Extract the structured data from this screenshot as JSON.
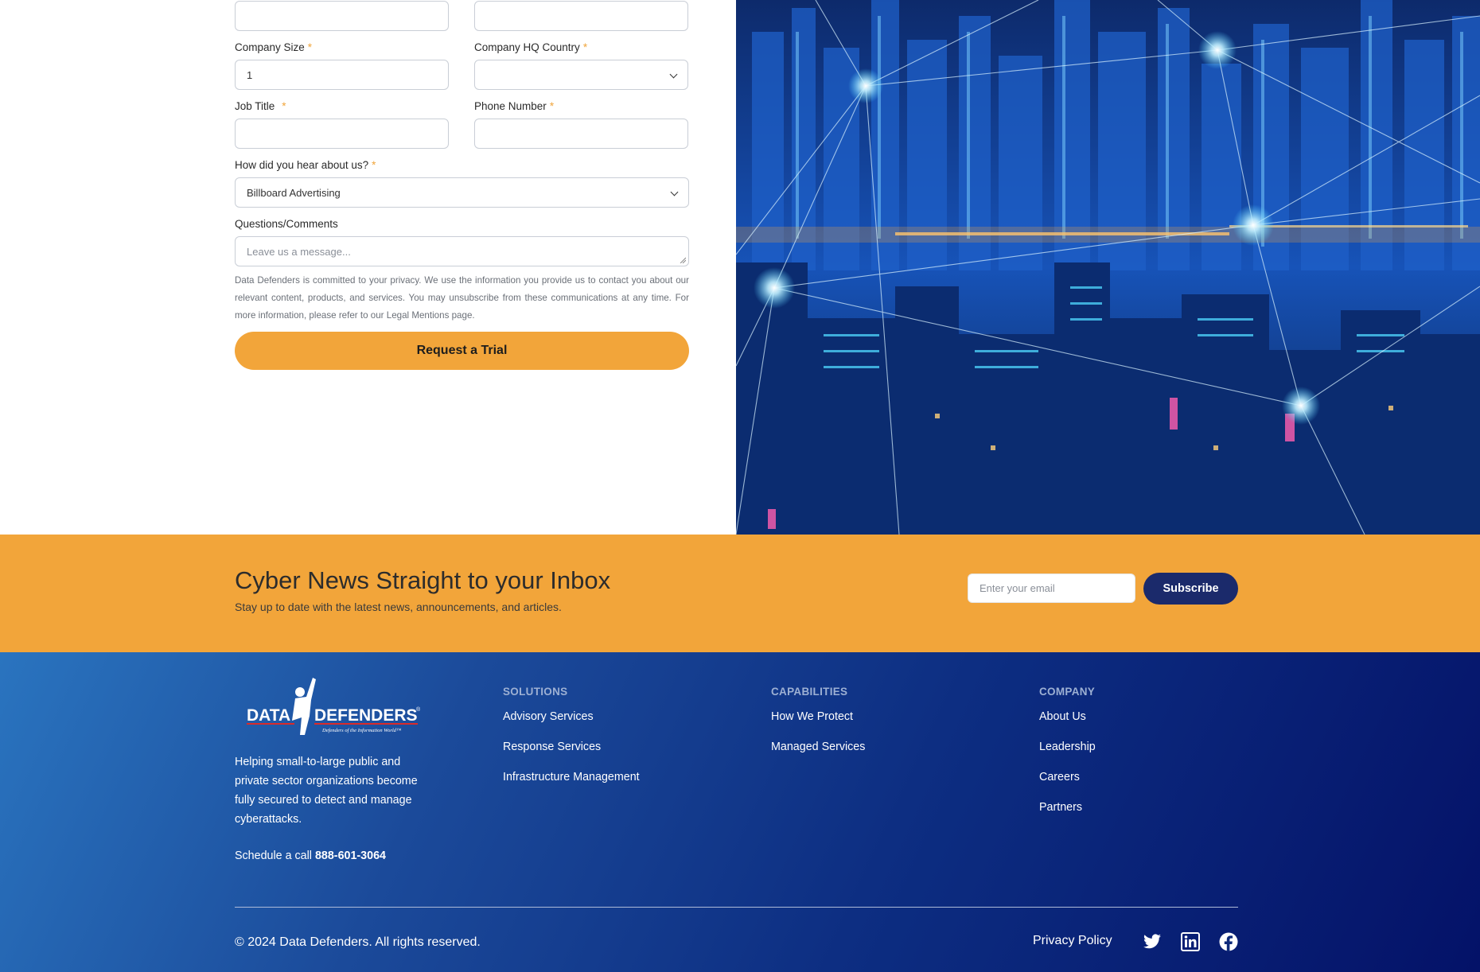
{
  "form": {
    "company_size_label": "Company Size",
    "company_size_value": "1",
    "hq_country_label": "Company HQ Country",
    "hq_country_value": "",
    "job_title_label": "Job Title",
    "phone_label": "Phone Number",
    "hear_label": "How did you hear about us?",
    "hear_value": "Billboard Advertising",
    "comments_label": "Questions/Comments",
    "comments_placeholder": "Leave us a message...",
    "required_mark": "*",
    "privacy_text": "Data Defenders is committed to your privacy. We use the information you provide us to contact you about our relevant content, products, and services. You may unsubscribe from these communications at any time. For more information, please refer to our Legal Mentions page.",
    "submit_label": "Request a Trial"
  },
  "newsletter": {
    "title": "Cyber News Straight to your Inbox",
    "subtitle": "Stay up to date with the latest news, announcements, and articles.",
    "email_placeholder": "Enter your email",
    "subscribe_label": "Subscribe"
  },
  "footer": {
    "logo_text": "DATA DEFENDERS",
    "logo_tagline": "Defenders of the Information World",
    "tagline": "Helping small-to-large public and private sector organizations become fully secured to detect and manage cyberattacks.",
    "schedule_label": "Schedule a call",
    "schedule_phone": "888-601-3064",
    "columns": [
      {
        "heading": "SOLUTIONS",
        "links": [
          "Advisory Services",
          "Response Services",
          "Infrastructure Management"
        ]
      },
      {
        "heading": "CAPABILITIES",
        "links": [
          "How We Protect",
          "Managed Services"
        ]
      },
      {
        "heading": "COMPANY",
        "links": [
          "About Us",
          "Leadership",
          "Careers",
          "Partners"
        ]
      }
    ],
    "copyright": "© 2024 Data Defenders. All rights reserved.",
    "privacy_policy": "Privacy Policy",
    "social_icons": [
      "twitter-icon",
      "linkedin-icon",
      "facebook-icon"
    ]
  },
  "colors": {
    "accent": "#f2a53a",
    "navy_button": "#1b2a6b",
    "footer_start": "#2a74bf",
    "footer_end": "#041268"
  }
}
